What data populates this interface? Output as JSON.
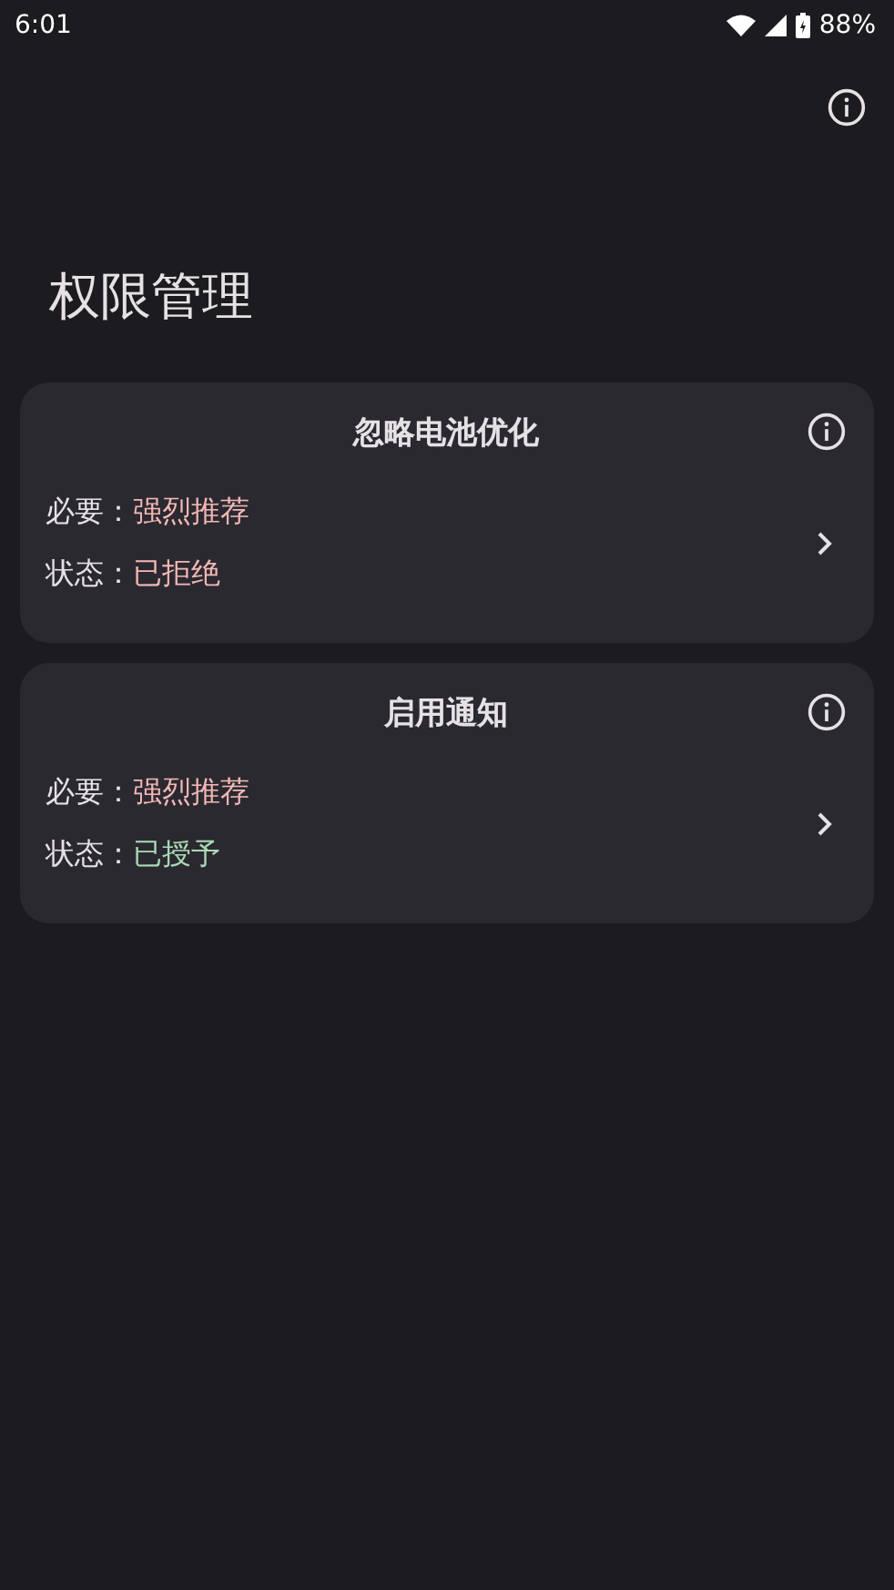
{
  "status_bar": {
    "time": "6:01",
    "battery": "88%"
  },
  "title": "权限管理",
  "cards": [
    {
      "title": "忽略电池优化",
      "rows": [
        {
          "label": "必要：",
          "value": "强烈推荐",
          "color": "#f2b8b5"
        },
        {
          "label": "状态：",
          "value": "已拒绝",
          "color": "#f2b8b5"
        }
      ]
    },
    {
      "title": "启用通知",
      "rows": [
        {
          "label": "必要：",
          "value": "强烈推荐",
          "color": "#f2b8b5"
        },
        {
          "label": "状态：",
          "value": "已授予",
          "color": "#a8dab5"
        }
      ]
    }
  ]
}
